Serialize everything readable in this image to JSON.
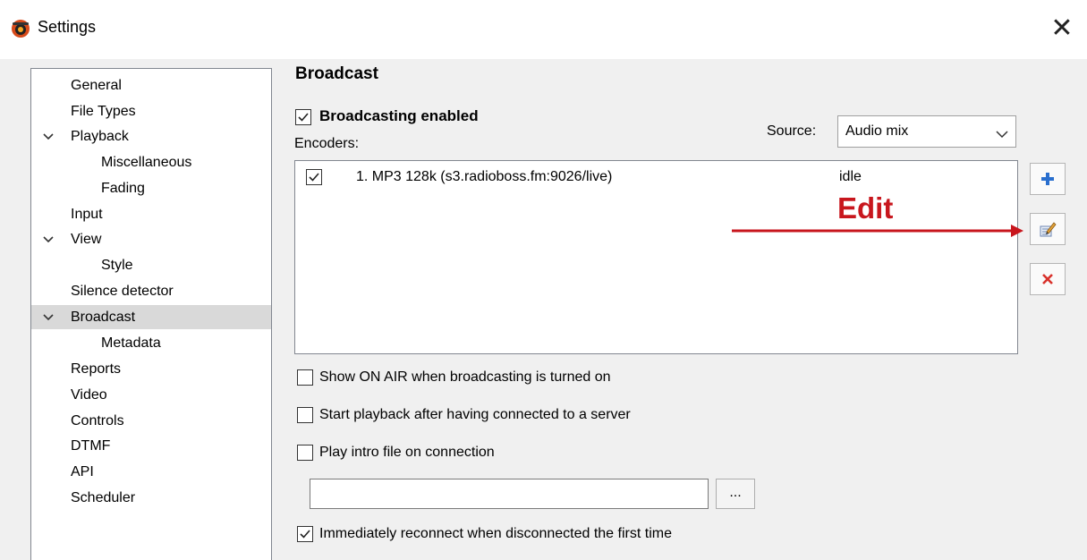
{
  "window": {
    "title": "Settings",
    "close_glyph": "✕"
  },
  "nav": {
    "items": [
      {
        "label": "General",
        "level": 0
      },
      {
        "label": "File Types",
        "level": 0
      },
      {
        "label": "Playback",
        "level": 0,
        "expanded": true
      },
      {
        "label": "Miscellaneous",
        "level": 1
      },
      {
        "label": "Fading",
        "level": 1
      },
      {
        "label": "Input",
        "level": 0
      },
      {
        "label": "View",
        "level": 0,
        "expanded": true
      },
      {
        "label": "Style",
        "level": 1
      },
      {
        "label": "Silence detector",
        "level": 0
      },
      {
        "label": "Broadcast",
        "level": 0,
        "expanded": true,
        "selected": true
      },
      {
        "label": "Metadata",
        "level": 1
      },
      {
        "label": "Reports",
        "level": 0
      },
      {
        "label": "Video",
        "level": 0
      },
      {
        "label": "Controls",
        "level": 0
      },
      {
        "label": "DTMF",
        "level": 0
      },
      {
        "label": "API",
        "level": 0
      },
      {
        "label": "Scheduler",
        "level": 0
      }
    ]
  },
  "broadcast": {
    "title": "Broadcast",
    "enabled_label": "Broadcasting enabled",
    "enabled_checked": true,
    "encoders_label": "Encoders:",
    "source_label": "Source:",
    "source_value": "Audio mix",
    "encoders": [
      {
        "name": "1. MP3 128k (s3.radioboss.fm:9026/live)",
        "status": "idle",
        "checked": true
      }
    ],
    "buttons": {
      "add_icon": "plus-icon",
      "edit_icon": "edit-icon",
      "delete_icon": "delete-icon"
    },
    "annotation": "Edit",
    "options": [
      {
        "label": "Show ON AIR when broadcasting is turned on",
        "checked": false
      },
      {
        "label": "Start playback after having connected to a server",
        "checked": false
      },
      {
        "label": "Play intro file on connection",
        "checked": false
      }
    ],
    "intro_file": {
      "value": "",
      "browse_label": "..."
    },
    "reconnect": {
      "label": "Immediately reconnect when disconnected the first time",
      "checked": true
    }
  },
  "colors": {
    "annotation": "#c8161d",
    "selected_bg": "#d9d9d9",
    "plus": "#2a6fce",
    "delete": "#d8312b"
  }
}
